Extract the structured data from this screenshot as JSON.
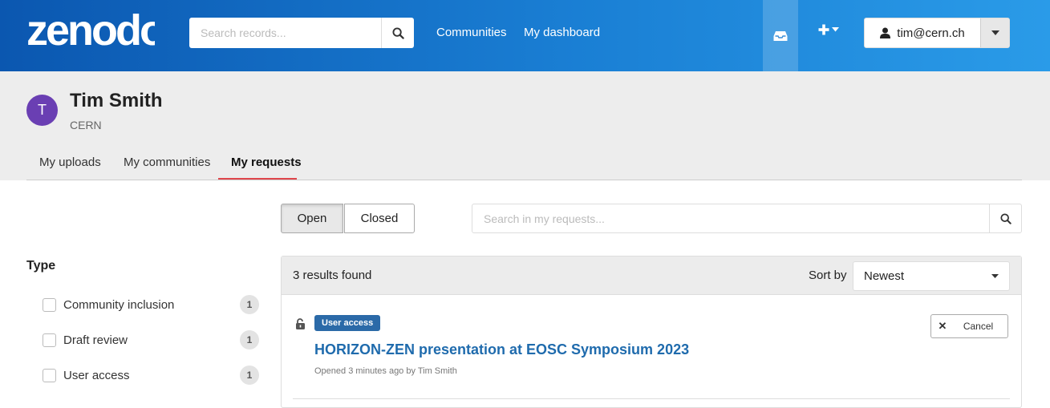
{
  "header": {
    "logo_text": "zenodo",
    "search_placeholder": "Search records...",
    "nav": [
      "Communities",
      "My dashboard"
    ],
    "user_email": "tim@cern.ch",
    "colors": {
      "gradient_start": "#0b57b0",
      "gradient_end": "#2a9be8"
    }
  },
  "profile": {
    "avatar_initial": "T",
    "name": "Tim Smith",
    "organization": "CERN",
    "tabs": [
      "My uploads",
      "My communities",
      "My requests"
    ],
    "active_tab": "My requests"
  },
  "filters": {
    "status_buttons": [
      "Open",
      "Closed"
    ],
    "active_status": "Open",
    "search_placeholder": "Search in my requests...",
    "facet_title": "Type",
    "facets": [
      {
        "label": "Community inclusion",
        "count": "1"
      },
      {
        "label": "Draft review",
        "count": "1"
      },
      {
        "label": "User access",
        "count": "1"
      }
    ]
  },
  "results": {
    "count_text": "3 results found",
    "sort_label": "Sort by",
    "sort_value": "Newest",
    "items": [
      {
        "badge": "User access",
        "title": "HORIZON-ZEN presentation at EOSC Symposium 2023",
        "meta": "Opened 3 minutes ago by Tim Smith",
        "cancel_label": "Cancel",
        "icon": "lock-open-icon"
      }
    ]
  }
}
